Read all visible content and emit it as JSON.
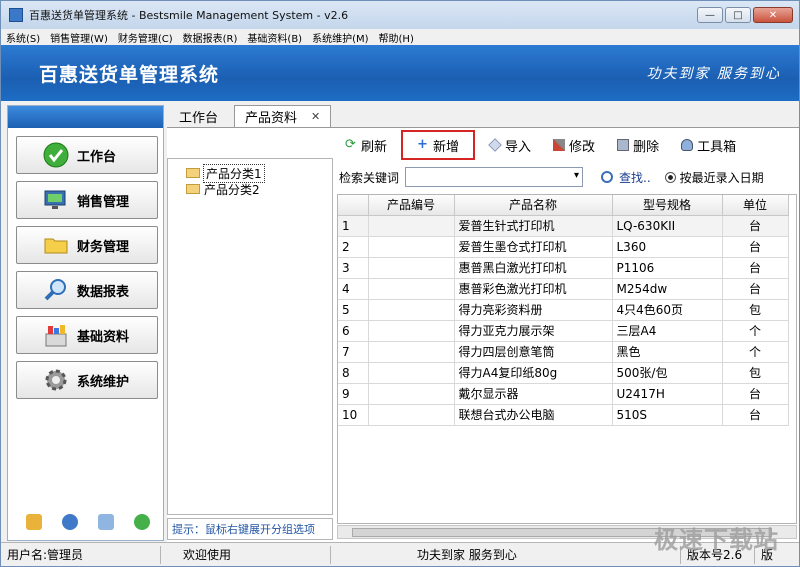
{
  "window": {
    "title": "百惠送货单管理系统 - Bestsmile Management System - v2.6",
    "btn_min": "—",
    "btn_max": "□",
    "btn_close": "✕"
  },
  "menu": [
    "系统(S)",
    "销售管理(W)",
    "财务管理(C)",
    "数据报表(R)",
    "基础资料(B)",
    "系统维护(M)",
    "帮助(H)"
  ],
  "banner": {
    "title": "百惠送货单管理系统",
    "slogan": "功夫到家 服务到心"
  },
  "nav": [
    {
      "label": "工作台",
      "icon": "check-icon"
    },
    {
      "label": "销售管理",
      "icon": "monitor-icon"
    },
    {
      "label": "财务管理",
      "icon": "folder-icon"
    },
    {
      "label": "数据报表",
      "icon": "magnifier-icon"
    },
    {
      "label": "基础资料",
      "icon": "colorful-box-icon"
    },
    {
      "label": "系统维护",
      "icon": "gear-icon"
    }
  ],
  "tabs": {
    "workbench": "工作台",
    "product": "产品资料",
    "close": "✕"
  },
  "tree": [
    "产品分类1",
    "产品分类2"
  ],
  "hint": "提示：鼠标右键展开分组选项",
  "toolbar": {
    "refresh": "刷新",
    "add": "新增",
    "import": "导入",
    "edit": "修改",
    "delete": "删除",
    "tools": "工具箱"
  },
  "search": {
    "label": "检索关键词",
    "find": "查找..",
    "radio": "按最近录入日期"
  },
  "table": {
    "headers": [
      "",
      "产品编号",
      "产品名称",
      "型号规格",
      "单位"
    ],
    "rows": [
      [
        "1",
        "",
        "爱普生针式打印机",
        "LQ-630KII",
        "台"
      ],
      [
        "2",
        "",
        "爱普生墨仓式打印机",
        "L360",
        "台"
      ],
      [
        "3",
        "",
        "惠普黑白激光打印机",
        "P1106",
        "台"
      ],
      [
        "4",
        "",
        "惠普彩色激光打印机",
        "M254dw",
        "台"
      ],
      [
        "5",
        "",
        "得力亮彩资料册",
        "4只4色60页",
        "包"
      ],
      [
        "6",
        "",
        "得力亚克力展示架",
        "三层A4",
        "个"
      ],
      [
        "7",
        "",
        "得力四层创意笔筒",
        "黑色",
        "个"
      ],
      [
        "8",
        "",
        "得力A4复印纸80g",
        "500张/包",
        "包"
      ],
      [
        "9",
        "",
        "戴尔显示器",
        "U2417H",
        "台"
      ],
      [
        "10",
        "",
        "联想台式办公电脑",
        "510S",
        "台"
      ]
    ]
  },
  "status": {
    "user": "用户名:管理员",
    "welcome": "欢迎使用",
    "slogan": "功夫到家 服务到心",
    "version": "版本号2.6",
    "extra": "版"
  },
  "watermark": "极速下载站"
}
